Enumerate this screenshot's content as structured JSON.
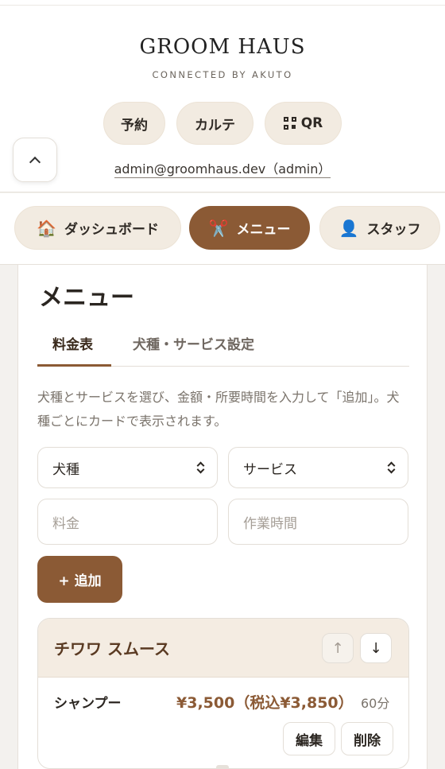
{
  "header": {
    "brand": "GROOM HAUS",
    "tagline": "CONNECTED BY AKUTO",
    "pills": [
      {
        "label": "予約"
      },
      {
        "label": "カルテ"
      },
      {
        "label": "QR",
        "icon": "qr-code-icon"
      }
    ],
    "account": "admin@groomhaus.dev（admin）"
  },
  "nav": {
    "items": [
      {
        "label": "ダッシュボード",
        "icon": "🏠",
        "icon_name": "house-icon",
        "active": false
      },
      {
        "label": "メニュー",
        "icon": "✂️",
        "icon_name": "scissors-icon",
        "active": true
      },
      {
        "label": "スタッフ",
        "icon": "👤",
        "icon_name": "person-icon",
        "active": false
      }
    ]
  },
  "main": {
    "title": "メニュー",
    "tabs": [
      {
        "label": "料金表",
        "active": true
      },
      {
        "label": "犬種・サービス設定",
        "active": false
      }
    ],
    "description": "犬種とサービスを選び、金額・所要時間を入力して「追加」。犬種ごとにカードで表示されます。",
    "form": {
      "breed_select": "犬種",
      "service_select": "サービス",
      "price_placeholder": "料金",
      "duration_placeholder": "作業時間",
      "add_label": "+ 追加"
    },
    "breed_cards": [
      {
        "name": "チワワ スムース",
        "services": [
          {
            "name": "シャンプー",
            "price": "¥3,500（税込¥3,850）",
            "duration": "60分",
            "edit_label": "編集",
            "delete_label": "削除"
          }
        ]
      }
    ]
  },
  "colors": {
    "accent": "#8b5a35",
    "pill_bg": "#f2ebe1",
    "page_bg": "#f3f1ee"
  }
}
